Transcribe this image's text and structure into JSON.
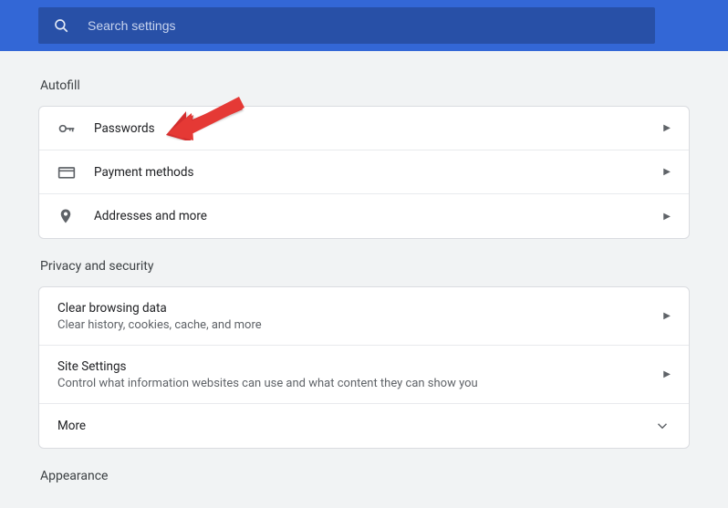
{
  "header": {
    "search_placeholder": "Search settings"
  },
  "autofill": {
    "title": "Autofill",
    "items": [
      {
        "label": "Passwords"
      },
      {
        "label": "Payment methods"
      },
      {
        "label": "Addresses and more"
      }
    ]
  },
  "privacy": {
    "title": "Privacy and security",
    "items": [
      {
        "title": "Clear browsing data",
        "sub": "Clear history, cookies, cache, and more"
      },
      {
        "title": "Site Settings",
        "sub": "Control what information websites can use and what content they can show you"
      },
      {
        "title": "More"
      }
    ]
  },
  "appearance": {
    "title": "Appearance"
  }
}
